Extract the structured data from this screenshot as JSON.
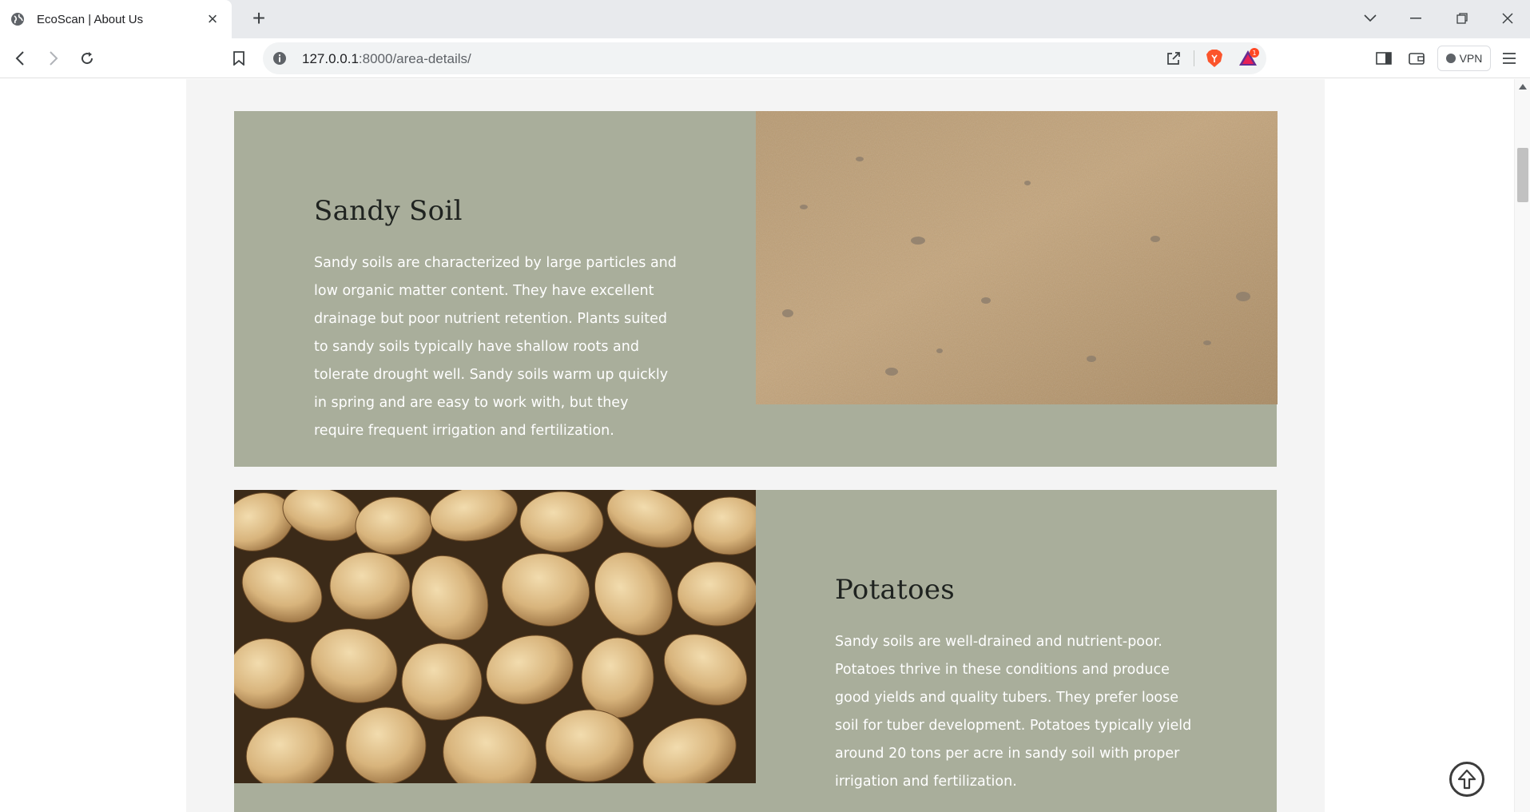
{
  "browser": {
    "tab_title": "EcoScan | About Us",
    "url_host": "127.0.0.1",
    "url_path": ":8000/area-details/",
    "vpn_label": "VPN",
    "notification_count": "1"
  },
  "sections": [
    {
      "heading": "Sandy Soil",
      "body": "Sandy soils are characterized by large particles and low organic matter content. They have excellent drainage but poor nutrient retention. Plants suited to sandy soils typically have shallow roots and tolerate drought well. Sandy soils warm up quickly in spring and are easy to work with, but they require frequent irrigation and fertilization.",
      "image": "sandy-soil-photo"
    },
    {
      "heading": "Potatoes",
      "body": "Sandy soils are well-drained and nutrient-poor. Potatoes thrive in these conditions and produce good yields and quality tubers. They prefer loose soil for tuber development. Potatoes typically yield around 20 tons per acre in sandy soil with proper irrigation and fertilization.",
      "image": "potatoes-photo"
    }
  ],
  "colors": {
    "card_background": "#a9ae9b",
    "heading_text": "#1f2320",
    "body_text": "#ffffff"
  }
}
